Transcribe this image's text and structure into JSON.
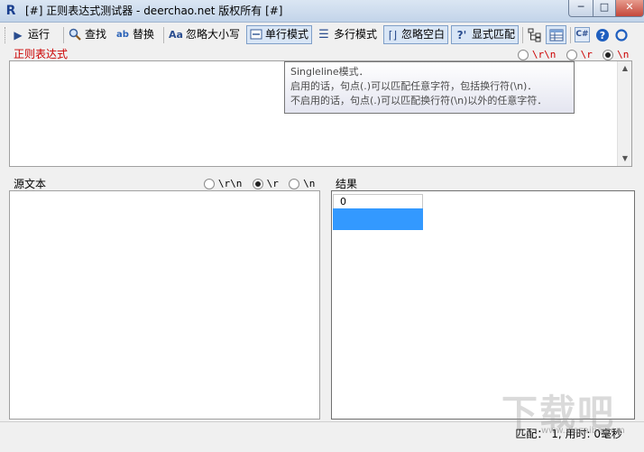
{
  "window": {
    "app_icon": "R",
    "title": "[#] 正则表达式测试器 - deerchao.net 版权所有 [#]",
    "min": "─",
    "max": "□",
    "close": "✕"
  },
  "toolbar": {
    "run": "运行",
    "find": "查找",
    "replace": "替换",
    "ignore_case": "忽略大小写",
    "singleline": "单行模式",
    "multiline": "多行模式",
    "ignore_whitespace": "忽略空白",
    "explicit_capture": "显式匹配",
    "icons": {
      "run": "play-icon",
      "find": "magnifier-icon",
      "replace": "replace-icon",
      "ignore_case": "case-icon",
      "singleline": "singleline-icon",
      "multiline": "multiline-icon",
      "ignore_whitespace": "bracket-icon",
      "explicit_capture": "question-icon",
      "tree": "tree-view-icon",
      "table": "table-view-icon",
      "csharp": "csharp-code-icon",
      "help": "help-icon",
      "about": "about-icon"
    }
  },
  "regex": {
    "label": "正则表达式",
    "value": "",
    "eol_options": [
      "\\r\\n",
      "\\r",
      "\\n"
    ],
    "eol_selected": "\\n"
  },
  "tooltip": {
    "line1": "Singleline模式．",
    "line2": "启用的话，句点(.)可以匹配任意字符，包括换行符(\\n)．",
    "line3": "不启用的话，句点(.)可以匹配换行符(\\n)以外的任意字符．"
  },
  "source": {
    "label": "源文本",
    "value": "",
    "eol_options": [
      "\\r\\n",
      "\\r",
      "\\n"
    ],
    "eol_selected": "\\r"
  },
  "result": {
    "label": "结果",
    "rows": [
      "0"
    ]
  },
  "status": {
    "text": "匹配：  1, 用时: 0毫秒"
  },
  "watermark": {
    "text": "下载吧",
    "url": "www.xiazaiba.com"
  },
  "colors": {
    "accent_red": "#cc0000",
    "selection_blue": "#3399ff"
  }
}
